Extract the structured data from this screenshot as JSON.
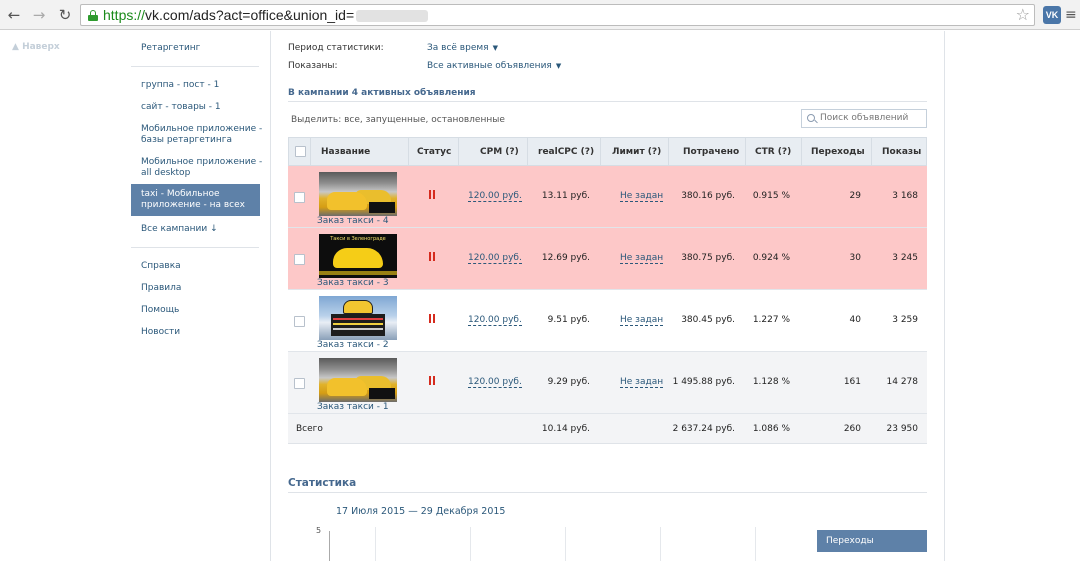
{
  "browser": {
    "url_scheme": "https://",
    "url_rest": "vk.com/ads?act=office&union_id=",
    "extension_label": "VK"
  },
  "nav": {
    "up_label": "Наверх"
  },
  "sidebar": {
    "retargeting": "Ретаргетинг",
    "campaigns": [
      {
        "label": "группа - пост - 1"
      },
      {
        "label": "сайт - товары - 1"
      },
      {
        "label": "Мобильное приложение - базы ретаргетинга"
      },
      {
        "label": "Мобильное приложение - all desktop"
      },
      {
        "label": "taxi - Мобильное приложение - на всех",
        "active": true
      }
    ],
    "all_campaigns": "Все кампании ↓",
    "links": [
      {
        "label": "Справка"
      },
      {
        "label": "Правила"
      },
      {
        "label": "Помощь"
      },
      {
        "label": "Новости"
      }
    ]
  },
  "filters": {
    "period_label": "Период статистики:",
    "period_value": "За всё время",
    "shown_label": "Показаны:",
    "shown_value": "Все активные объявления"
  },
  "campaign": {
    "heading": "В кампании 4 активных объявления",
    "select_filter": "Выделить: все, запущенные, остановленные",
    "search_placeholder": "Поиск объявлений"
  },
  "table": {
    "headers": {
      "name": "Название",
      "status": "Статус",
      "cpm": "CPM (?)",
      "realcpc": "realCPC (?)",
      "limit": "Лимит (?)",
      "spent": "Потрачено",
      "ctr": "CTR (?)",
      "clicks": "Переходы",
      "views": "Показы"
    },
    "rows": [
      {
        "name": "Заказ такси - 4",
        "cpm": "120.00 руб.",
        "realcpc": "13.11 руб.",
        "limit": "Не задан",
        "spent": "380.16 руб.",
        "ctr": "0.915 %",
        "clicks": "29",
        "views": "3 168",
        "highlight": "red",
        "thumb": "taxi-fleet"
      },
      {
        "name": "Заказ такси - 3",
        "cpm": "120.00 руб.",
        "realcpc": "12.69 руб.",
        "limit": "Не задан",
        "spent": "380.75 руб.",
        "ctr": "0.924 %",
        "clicks": "30",
        "views": "3 245",
        "highlight": "red",
        "thumb": "yellow-sportscar"
      },
      {
        "name": "Заказ такси - 2",
        "cpm": "120.00 руб.",
        "realcpc": "9.51 руб.",
        "limit": "Не задан",
        "spent": "380.45 руб.",
        "ctr": "1.227 %",
        "clicks": "40",
        "views": "3 259",
        "highlight": "none",
        "thumb": "taxi-sign"
      },
      {
        "name": "Заказ такси - 1",
        "cpm": "120.00 руб.",
        "realcpc": "9.29 руб.",
        "limit": "Не задан",
        "spent": "1 495.88 руб.",
        "ctr": "1.128 %",
        "clicks": "161",
        "views": "14 278",
        "highlight": "gray",
        "thumb": "taxi-fleet"
      }
    ],
    "total": {
      "label": "Всего",
      "realcpc": "10.14 руб.",
      "spent": "2 637.24 руб.",
      "ctr": "1.086 %",
      "clicks": "260",
      "views": "23 950"
    }
  },
  "stats": {
    "heading": "Статистика",
    "range": "17 Июля 2015 — 29 Декабря 2015",
    "y_top_tick": "5",
    "metric_tab": "Переходы"
  },
  "colors": {
    "link": "#2b587a",
    "active_sidebar": "#5e81a8",
    "paused_row": "#fdc8c8",
    "pause_icon": "#d52b1e"
  }
}
